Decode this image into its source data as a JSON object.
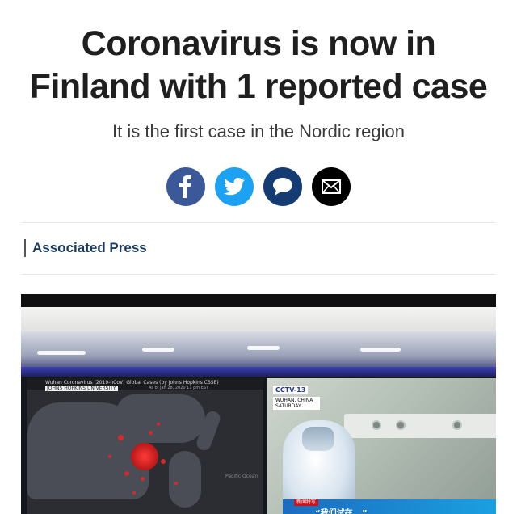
{
  "article": {
    "headline_line1": "Coronavirus is now in",
    "headline_line2": "Finland with 1 reported case",
    "subheadline": "It is the first case in the Nordic region",
    "byline": "Associated Press"
  },
  "share": [
    {
      "name": "facebook-share-button",
      "icon": "facebook-icon",
      "color": "#3b5998"
    },
    {
      "name": "twitter-share-button",
      "icon": "twitter-icon",
      "color": "#1da1f2"
    },
    {
      "name": "comment-share-button",
      "icon": "speech-bubble-icon",
      "color": "#143c73"
    },
    {
      "name": "email-share-button",
      "icon": "envelope-icon",
      "color": "#000000"
    }
  ],
  "photo": {
    "map_title": "Wuhan Coronavirus (2019-nCoV) Global Cases (by Johns Hopkins CSSE)",
    "map_source": "JOHNS HOPKINS UNIVERSITY",
    "map_timestamp": "As of Jan 28, 2020 11 pm EST",
    "map_label_ocean": "Pacific Ocean",
    "channel_logo": "CCTV-13",
    "location": "WUHAN, CHINA\nSATURDAY",
    "news_tag": "新闻特写",
    "caption": "“我们试在...”"
  },
  "colors": {
    "byline": "#1a3a5f",
    "headline": "#1f1f1f"
  }
}
